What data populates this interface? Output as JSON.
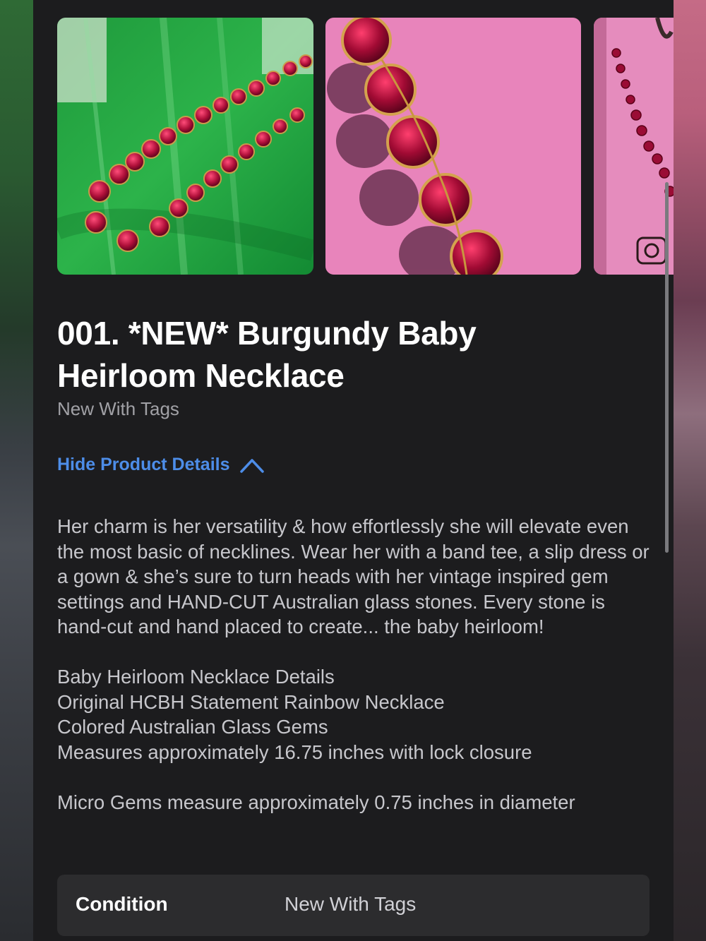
{
  "product": {
    "title": "001. *NEW* Burgundy Baby Heirloom Necklace",
    "subtitle": "New With Tags",
    "toggle_label": "Hide Product Details",
    "description_paragraph": "Her charm is her versatility & how effortlessly she will elevate even the most basic of necklines. Wear her with a band tee, a slip dress or a gown & she’s sure to turn heads with her vintage inspired gem settings and HAND-CUT Australian glass stones. Every stone is hand-cut and hand placed to create... the baby heirloom!",
    "details": [
      "Baby Heirloom Necklace Details",
      "Original HCBH Statement Rainbow Necklace",
      "Colored Australian Glass Gems",
      "Measures approximately 16.75 inches with lock closure"
    ],
    "extra": "Micro Gems measure approximately 0.75 inches in diameter"
  },
  "condition": {
    "label": "Condition",
    "value": "New With Tags"
  },
  "gallery": {
    "photos": [
      "necklace-on-green",
      "necklace-on-pink-closeup",
      "necklace-on-pink-card"
    ]
  },
  "colors": {
    "background": "#1c1c1e",
    "accent": "#4d8de8",
    "card": "#2c2c2e"
  }
}
